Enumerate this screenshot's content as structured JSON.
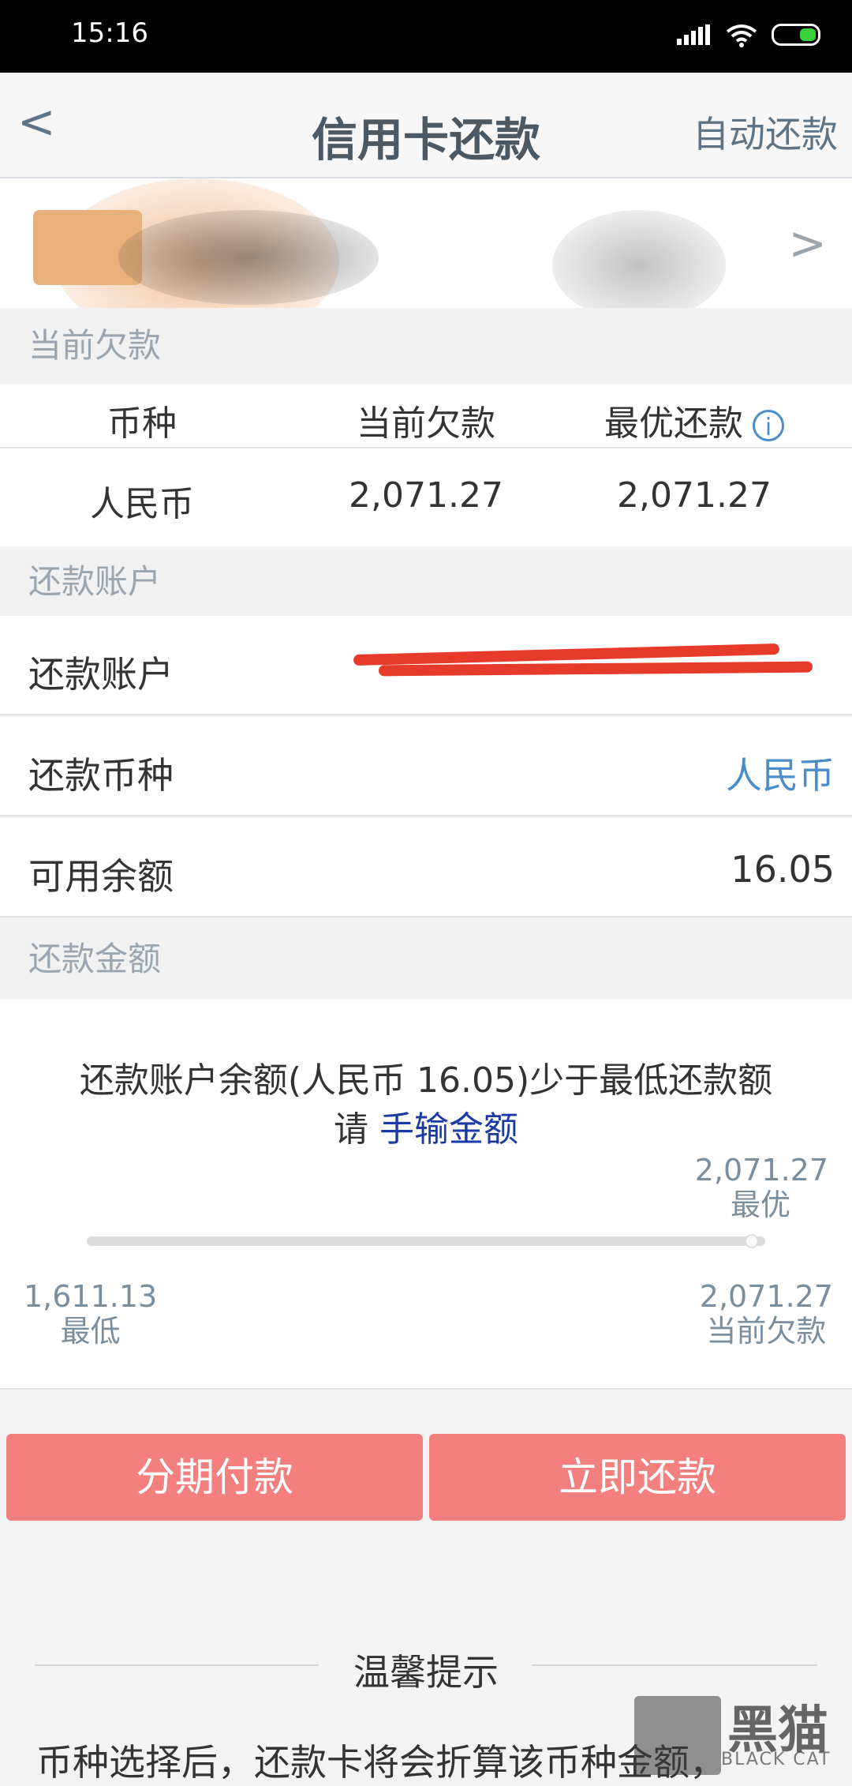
{
  "status_bar": {
    "time": "15:16"
  },
  "nav": {
    "back_symbol": "<",
    "title": "信用卡还款",
    "right_action": "自动还款"
  },
  "card": {
    "chevron_symbol": ">"
  },
  "debt_section": {
    "header": "当前欠款",
    "columns": [
      "币种",
      "当前欠款",
      "最优还款"
    ],
    "info_symbol": "i",
    "row": {
      "currency": "人民币",
      "current_debt": "2,071.27",
      "optimal_payment": "2,071.27"
    }
  },
  "account_section": {
    "header": "还款账户",
    "account_label": "还款账户",
    "currency_label": "还款币种",
    "currency_value": "人民币",
    "balance_label": "可用余额",
    "balance_value": "16.05"
  },
  "amount_section": {
    "header": "还款金额",
    "message_line1": "还款账户余额(人民币 16.05)少于最低还款额",
    "message_prefix": "请",
    "manual_link": "手输金额",
    "slider": {
      "optimal_value": "2,071.27",
      "optimal_label": "最优",
      "min_value": "1,611.13",
      "min_label": "最低",
      "current_value": "2,071.27",
      "current_label": "当前欠款",
      "position": 0.98
    }
  },
  "actions": {
    "installment": "分期付款",
    "pay_now": "立即还款"
  },
  "tips": {
    "title": "温馨提示",
    "text": "币种选择后，还款卡将会折算该币种金额，"
  },
  "watermark": {
    "text": "黑猫",
    "sub": "BLACK CAT"
  },
  "colors": {
    "button": "#f37f7f",
    "link": "#1a3aa6",
    "currency": "#4a8dc8"
  }
}
